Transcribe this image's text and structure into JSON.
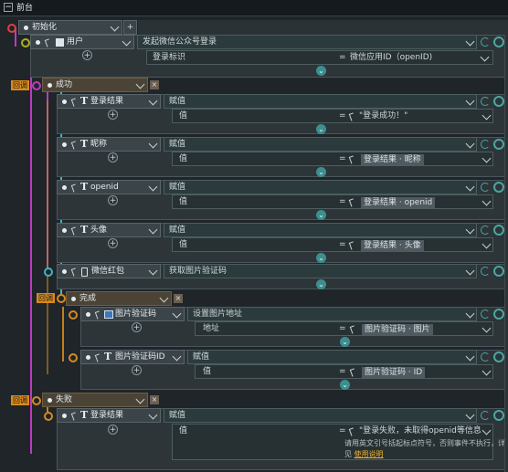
{
  "header": {
    "collapse": "−",
    "title": "前台"
  },
  "root": {
    "label": "初始化",
    "plus": "+"
  },
  "user_node": {
    "label": "用户",
    "action": "发起微信公众号登录",
    "param_label": "登录标识",
    "eq": "=",
    "param_value": "微信应用ID（openID)"
  },
  "success_block": {
    "callback_tag": "回调",
    "label": "成功"
  },
  "success_nodes": [
    {
      "label": "登录结果",
      "action": "赋值",
      "field": "值",
      "eq": "=",
      "value": "\"登录成功！\"",
      "chip": false
    },
    {
      "label": "昵称",
      "action": "赋值",
      "field": "值",
      "eq": "=",
      "value": "登录结果 · 昵称",
      "chip": true
    },
    {
      "label": "openid",
      "action": "赋值",
      "field": "值",
      "eq": "=",
      "value": "登录结果 · openid",
      "chip": true
    },
    {
      "label": "头像",
      "action": "赋值",
      "field": "值",
      "eq": "=",
      "value": "登录结果 · 头像",
      "chip": true
    }
  ],
  "redpack_node": {
    "label": "微信红包",
    "action": "获取图片验证码"
  },
  "done_block": {
    "callback_tag": "回调",
    "label": "完成"
  },
  "done_nodes": [
    {
      "label": "图片验证码",
      "action": "设置图片地址",
      "field": "地址",
      "eq": "=",
      "value": "图片验证码 · 图片"
    },
    {
      "label": "图片验证码ID",
      "action": "赋值",
      "field": "值",
      "eq": "=",
      "value": "图片验证码 · ID"
    }
  ],
  "fail_block": {
    "callback_tag": "回调",
    "label": "失败"
  },
  "fail_node": {
    "label": "登录结果",
    "action": "赋值",
    "field": "值",
    "eq": "=",
    "value": "\"登录失败，未取得openid等信息，请重",
    "note_line1": "请用英文引号括起标点符号，否则事件不执行，详",
    "note_line2_prefix": "见 ",
    "note_link": "使用说明"
  },
  "colors": {
    "accent_teal": "#3d8f8f",
    "tag_orange": "#d88a1c",
    "line_magenta": "#c03ac0",
    "line_cyan": "#3ab8c0"
  },
  "icons": [
    "collapse-icon",
    "dropdown-icon",
    "pointer-icon",
    "user-icon",
    "text-T-icon",
    "image-icon",
    "device-icon",
    "gear-icon",
    "cycle-icon",
    "plus-icon",
    "close-icon"
  ]
}
